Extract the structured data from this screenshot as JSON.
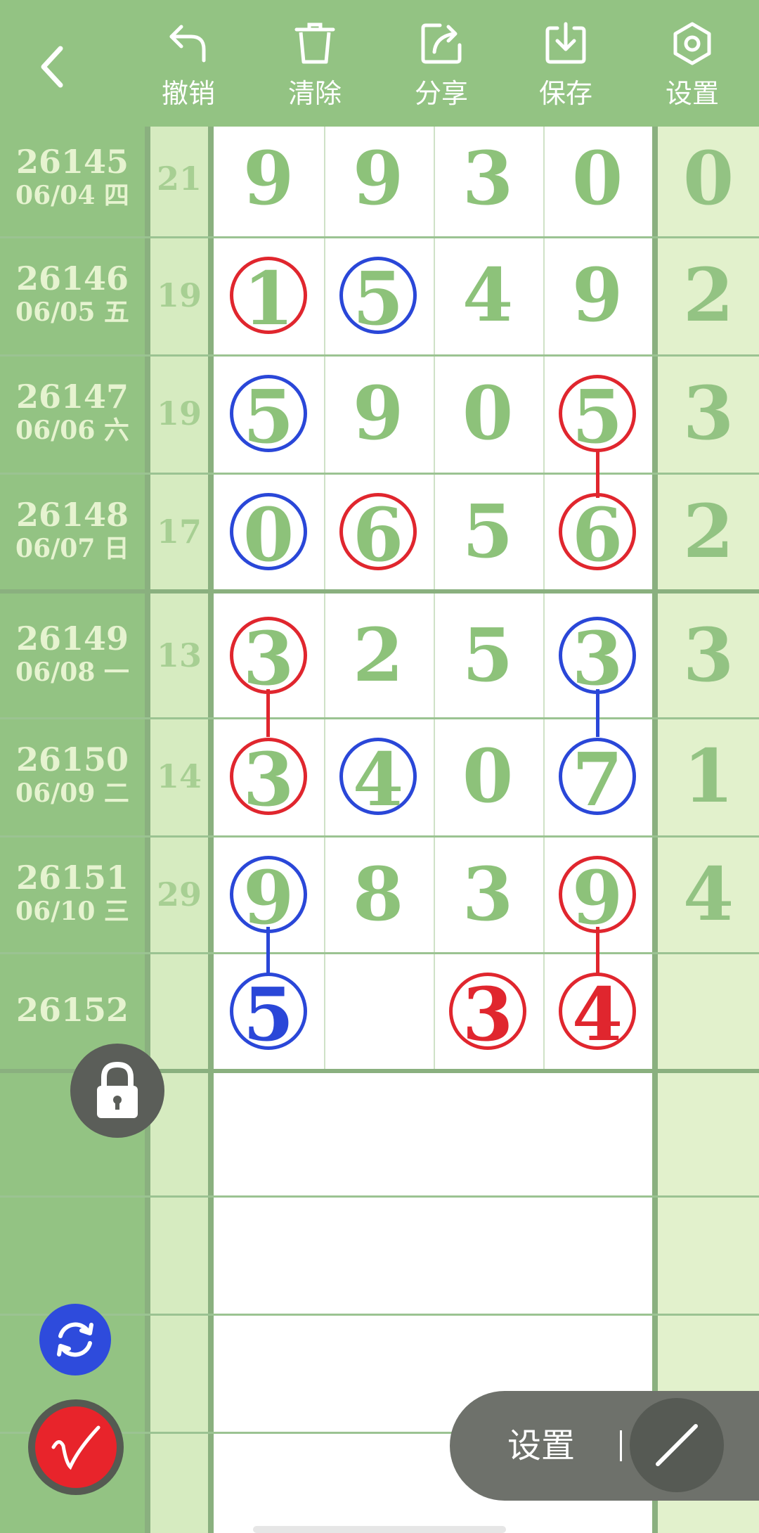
{
  "toolbar": {
    "undo": "撤销",
    "clear": "清除",
    "share": "分享",
    "save": "保存",
    "settings": "设置"
  },
  "rows": [
    {
      "issue": "26145",
      "date": "06/04 四",
      "sum": "21",
      "digits": [
        "9",
        "9",
        "3",
        "0"
      ],
      "last": "0"
    },
    {
      "issue": "26146",
      "date": "06/05 五",
      "sum": "19",
      "digits": [
        "1",
        "5",
        "4",
        "9"
      ],
      "last": "2"
    },
    {
      "issue": "26147",
      "date": "06/06 六",
      "sum": "19",
      "digits": [
        "5",
        "9",
        "0",
        "5"
      ],
      "last": "3"
    },
    {
      "issue": "26148",
      "date": "06/07 日",
      "sum": "17",
      "digits": [
        "0",
        "6",
        "5",
        "6"
      ],
      "last": "2"
    },
    {
      "issue": "26149",
      "date": "06/08 一",
      "sum": "13",
      "digits": [
        "3",
        "2",
        "5",
        "3"
      ],
      "last": "3"
    },
    {
      "issue": "26150",
      "date": "06/09 二",
      "sum": "14",
      "digits": [
        "3",
        "4",
        "0",
        "7"
      ],
      "last": "1"
    },
    {
      "issue": "26151",
      "date": "06/10 三",
      "sum": "29",
      "digits": [
        "9",
        "8",
        "3",
        "9"
      ],
      "last": "4"
    },
    {
      "issue": "26152",
      "date": "",
      "sum": "",
      "digits": [
        "5",
        "",
        "3",
        "4"
      ],
      "last": ""
    }
  ],
  "bottom": {
    "settings_label": "设置"
  },
  "colors": {
    "toolbar": "#93c383",
    "digit": "#8dc27a",
    "red": "#e0262e",
    "blue": "#2a47d8"
  },
  "icons": [
    "back-icon",
    "undo-icon",
    "trash-icon",
    "share-icon",
    "save-icon",
    "settings-icon",
    "lock-icon",
    "refresh-icon",
    "pen-icon",
    "line-icon"
  ]
}
